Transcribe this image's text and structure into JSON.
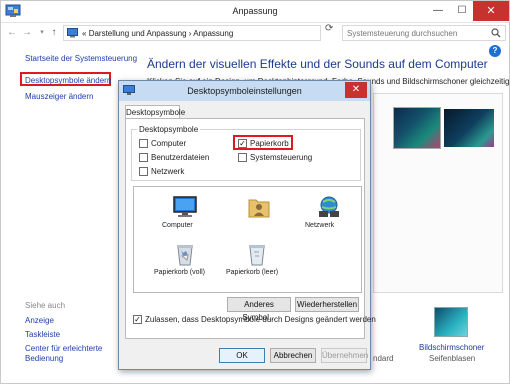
{
  "window": {
    "title": "Anpassung",
    "controls": {
      "minimize": "—",
      "maximize": "☐",
      "close": "✕"
    }
  },
  "address": {
    "history": "«",
    "breadcrumb_1": "Darstellung und Anpassung",
    "separator": "›",
    "breadcrumb_2": "Anpassung",
    "search_placeholder": "Systemsteuerung durchsuchen"
  },
  "sidebar": {
    "items": [
      {
        "label": "Startseite der Systemsteuerung"
      },
      {
        "label": "Desktopsymbole ändern"
      },
      {
        "label": "Mauszeiger ändern"
      }
    ],
    "see_also_header": "Siehe auch",
    "see_also": [
      {
        "label": "Anzeige"
      },
      {
        "label": "Taskleiste"
      },
      {
        "label": "Center für erleichterte"
      },
      {
        "label": "Bedienung"
      }
    ]
  },
  "content": {
    "title": "Ändern der visuellen Effekte und der Sounds auf dem Computer",
    "subtitle": "Klicken Sie auf ein Design, um Desktophintergrund, Farbe, Sounds und Bildschirmschoner gleichzeitig zu",
    "std_peek": "ndard",
    "screensaver_label": "Bildschirmschoner",
    "screensaver_sub": "Seifenblasen"
  },
  "dialog": {
    "title": "Desktopsymboleinstellungen",
    "tab": "Desktopsymbole",
    "group_label": "Desktopsymbole",
    "checkboxes": [
      {
        "label": "Computer",
        "checked": false
      },
      {
        "label": "Papierkorb",
        "checked": true
      },
      {
        "label": "Benutzerdateien",
        "checked": false
      },
      {
        "label": "Systemsteuerung",
        "checked": false
      },
      {
        "label": "Netzwerk",
        "checked": false
      }
    ],
    "icons": [
      {
        "label": "Computer"
      },
      {
        "label": ""
      },
      {
        "label": "Netzwerk"
      },
      {
        "label": "Papierkorb (voll)"
      },
      {
        "label": "Papierkorb (leer)"
      }
    ],
    "buttons": {
      "change_icon": "Anderes Symbol...",
      "restore": "Wiederherstellen",
      "ok": "OK",
      "cancel": "Abbrechen",
      "apply": "Übernehmen"
    },
    "allow_themes": {
      "label": "Zulassen, dass Desktopsymbole durch Designs geändert werden",
      "checked": true
    },
    "check_mark": "✓"
  }
}
